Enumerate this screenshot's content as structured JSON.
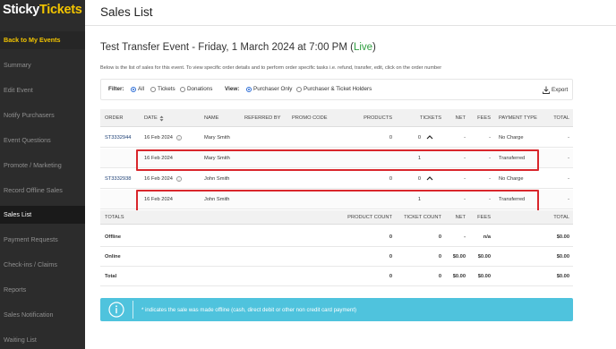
{
  "colors": {
    "sidebar_bg": "#2c2c2c",
    "brand_yellow": "#f2c400",
    "live_green": "#2e9d3f",
    "highlight_red": "#d9262c",
    "banner_blue": "#4fc3dd"
  },
  "logo": {
    "part1": "Sticky",
    "part2": "Tickets"
  },
  "sidebar": {
    "items": [
      {
        "label": "Back to My Events"
      },
      {
        "label": "Summary"
      },
      {
        "label": "Edit Event"
      },
      {
        "label": "Notify Purchasers"
      },
      {
        "label": "Event Questions"
      },
      {
        "label": "Promote / Marketing"
      },
      {
        "label": "Record Offline Sales"
      },
      {
        "label": "Sales List"
      },
      {
        "label": "Payment Requests"
      },
      {
        "label": "Check-ins / Claims"
      },
      {
        "label": "Reports"
      },
      {
        "label": "Sales Notification"
      },
      {
        "label": "Waiting List"
      }
    ]
  },
  "header": {
    "title": "Sales List"
  },
  "event": {
    "title": "Test Transfer Event - Friday, 1 March 2024 at 7:00 PM (",
    "status": "Live",
    "close": ")"
  },
  "description": "Below is the list of sales for this event. To view specific order details and to perform order specific tasks i.e. refund, transfer, edit, click on the order number",
  "filters": {
    "filter_label": "Filter:",
    "filter_options": [
      "All",
      "Tickets",
      "Donations"
    ],
    "view_label": "View:",
    "view_options": [
      "Purchaser Only",
      "Purchaser & Ticket Holders"
    ],
    "export_label": "Export",
    "export_icon": "export-icon"
  },
  "table": {
    "columns": [
      "ORDER",
      "DATE",
      "NAME",
      "REFERRED BY",
      "PROMO CODE",
      "PRODUCTS",
      "TICKETS",
      "NET",
      "FEES",
      "PAYMENT TYPE",
      "TOTAL"
    ],
    "rows": [
      {
        "order": "ST3332944",
        "date": "16 Feb 2024",
        "name": "Mary Smith",
        "products": "0",
        "tickets": "0",
        "net": "-",
        "fees": "-",
        "payment": "No Charge",
        "total": "-"
      },
      {
        "order": "",
        "date": "16 Feb 2024",
        "name": "Mary Smith",
        "products": "",
        "tickets": "1",
        "net": "-",
        "fees": "-",
        "payment": "Transferred",
        "total": "-"
      },
      {
        "order": "ST3332938",
        "date": "16 Feb 2024",
        "name": "John Smith",
        "products": "0",
        "tickets": "0",
        "net": "-",
        "fees": "-",
        "payment": "No Charge",
        "total": "-"
      },
      {
        "order": "",
        "date": "16 Feb 2024",
        "name": "John Smith",
        "products": "",
        "tickets": "1",
        "net": "-",
        "fees": "-",
        "payment": "Transferred",
        "total": "-"
      }
    ]
  },
  "totals": {
    "columns": [
      "TOTALS",
      "PRODUCT COUNT",
      "TICKET COUNT",
      "NET",
      "FEES",
      "TOTAL"
    ],
    "rows": [
      {
        "label": "Offline",
        "product_count": "0",
        "ticket_count": "0",
        "net": "-",
        "fees": "n/a",
        "total": "$0.00"
      },
      {
        "label": "Online",
        "product_count": "0",
        "ticket_count": "0",
        "net": "$0.00",
        "fees": "$0.00",
        "total": "$0.00"
      },
      {
        "label": "Total",
        "product_count": "0",
        "ticket_count": "0",
        "net": "$0.00",
        "fees": "$0.00",
        "total": "$0.00"
      }
    ]
  },
  "banner": {
    "icon": "info-icon",
    "text": "* indicates the sale was made offline (cash, direct debit or other non credit card payment)"
  }
}
